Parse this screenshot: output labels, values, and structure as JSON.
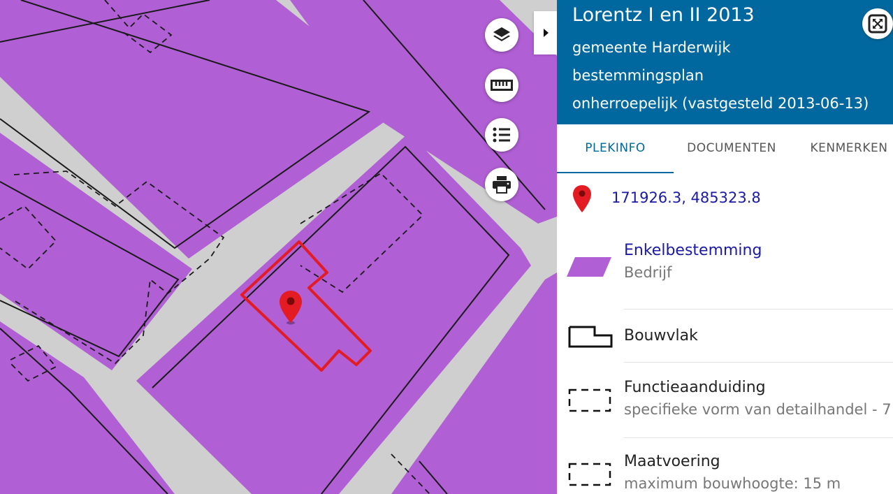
{
  "header": {
    "title": "Lorentz I en II 2013",
    "municipality": "gemeente Harderwijk",
    "type": "bestemmingsplan",
    "status": "onherroepelijk (vastgesteld 2013-06-13)"
  },
  "tabs": [
    {
      "label": "PLEKINFO"
    },
    {
      "label": "DOCUMENTEN"
    },
    {
      "label": "KENMERKEN"
    }
  ],
  "location": {
    "coordinates": "171926.3, 485323.8"
  },
  "items": [
    {
      "title": "Enkelbestemming",
      "subtitle": "Bedrijf"
    },
    {
      "title": "Bouwvlak",
      "subtitle": ""
    },
    {
      "title": "Functieaanduiding",
      "subtitle": "specifieke vorm van detailhandel - 7"
    },
    {
      "title": "Maatvoering",
      "subtitle": "maximum bouwhoogte: 15 m"
    }
  ],
  "map_tools": [
    "layers-icon",
    "ruler-icon",
    "list-icon",
    "printer-icon"
  ],
  "colors": {
    "header_bg": "#00689e",
    "zone_fill": "#b05fd4",
    "road": "#cfcfcf",
    "selection": "#e31b23",
    "accent": "#00689e",
    "link": "#1a1aa6"
  }
}
